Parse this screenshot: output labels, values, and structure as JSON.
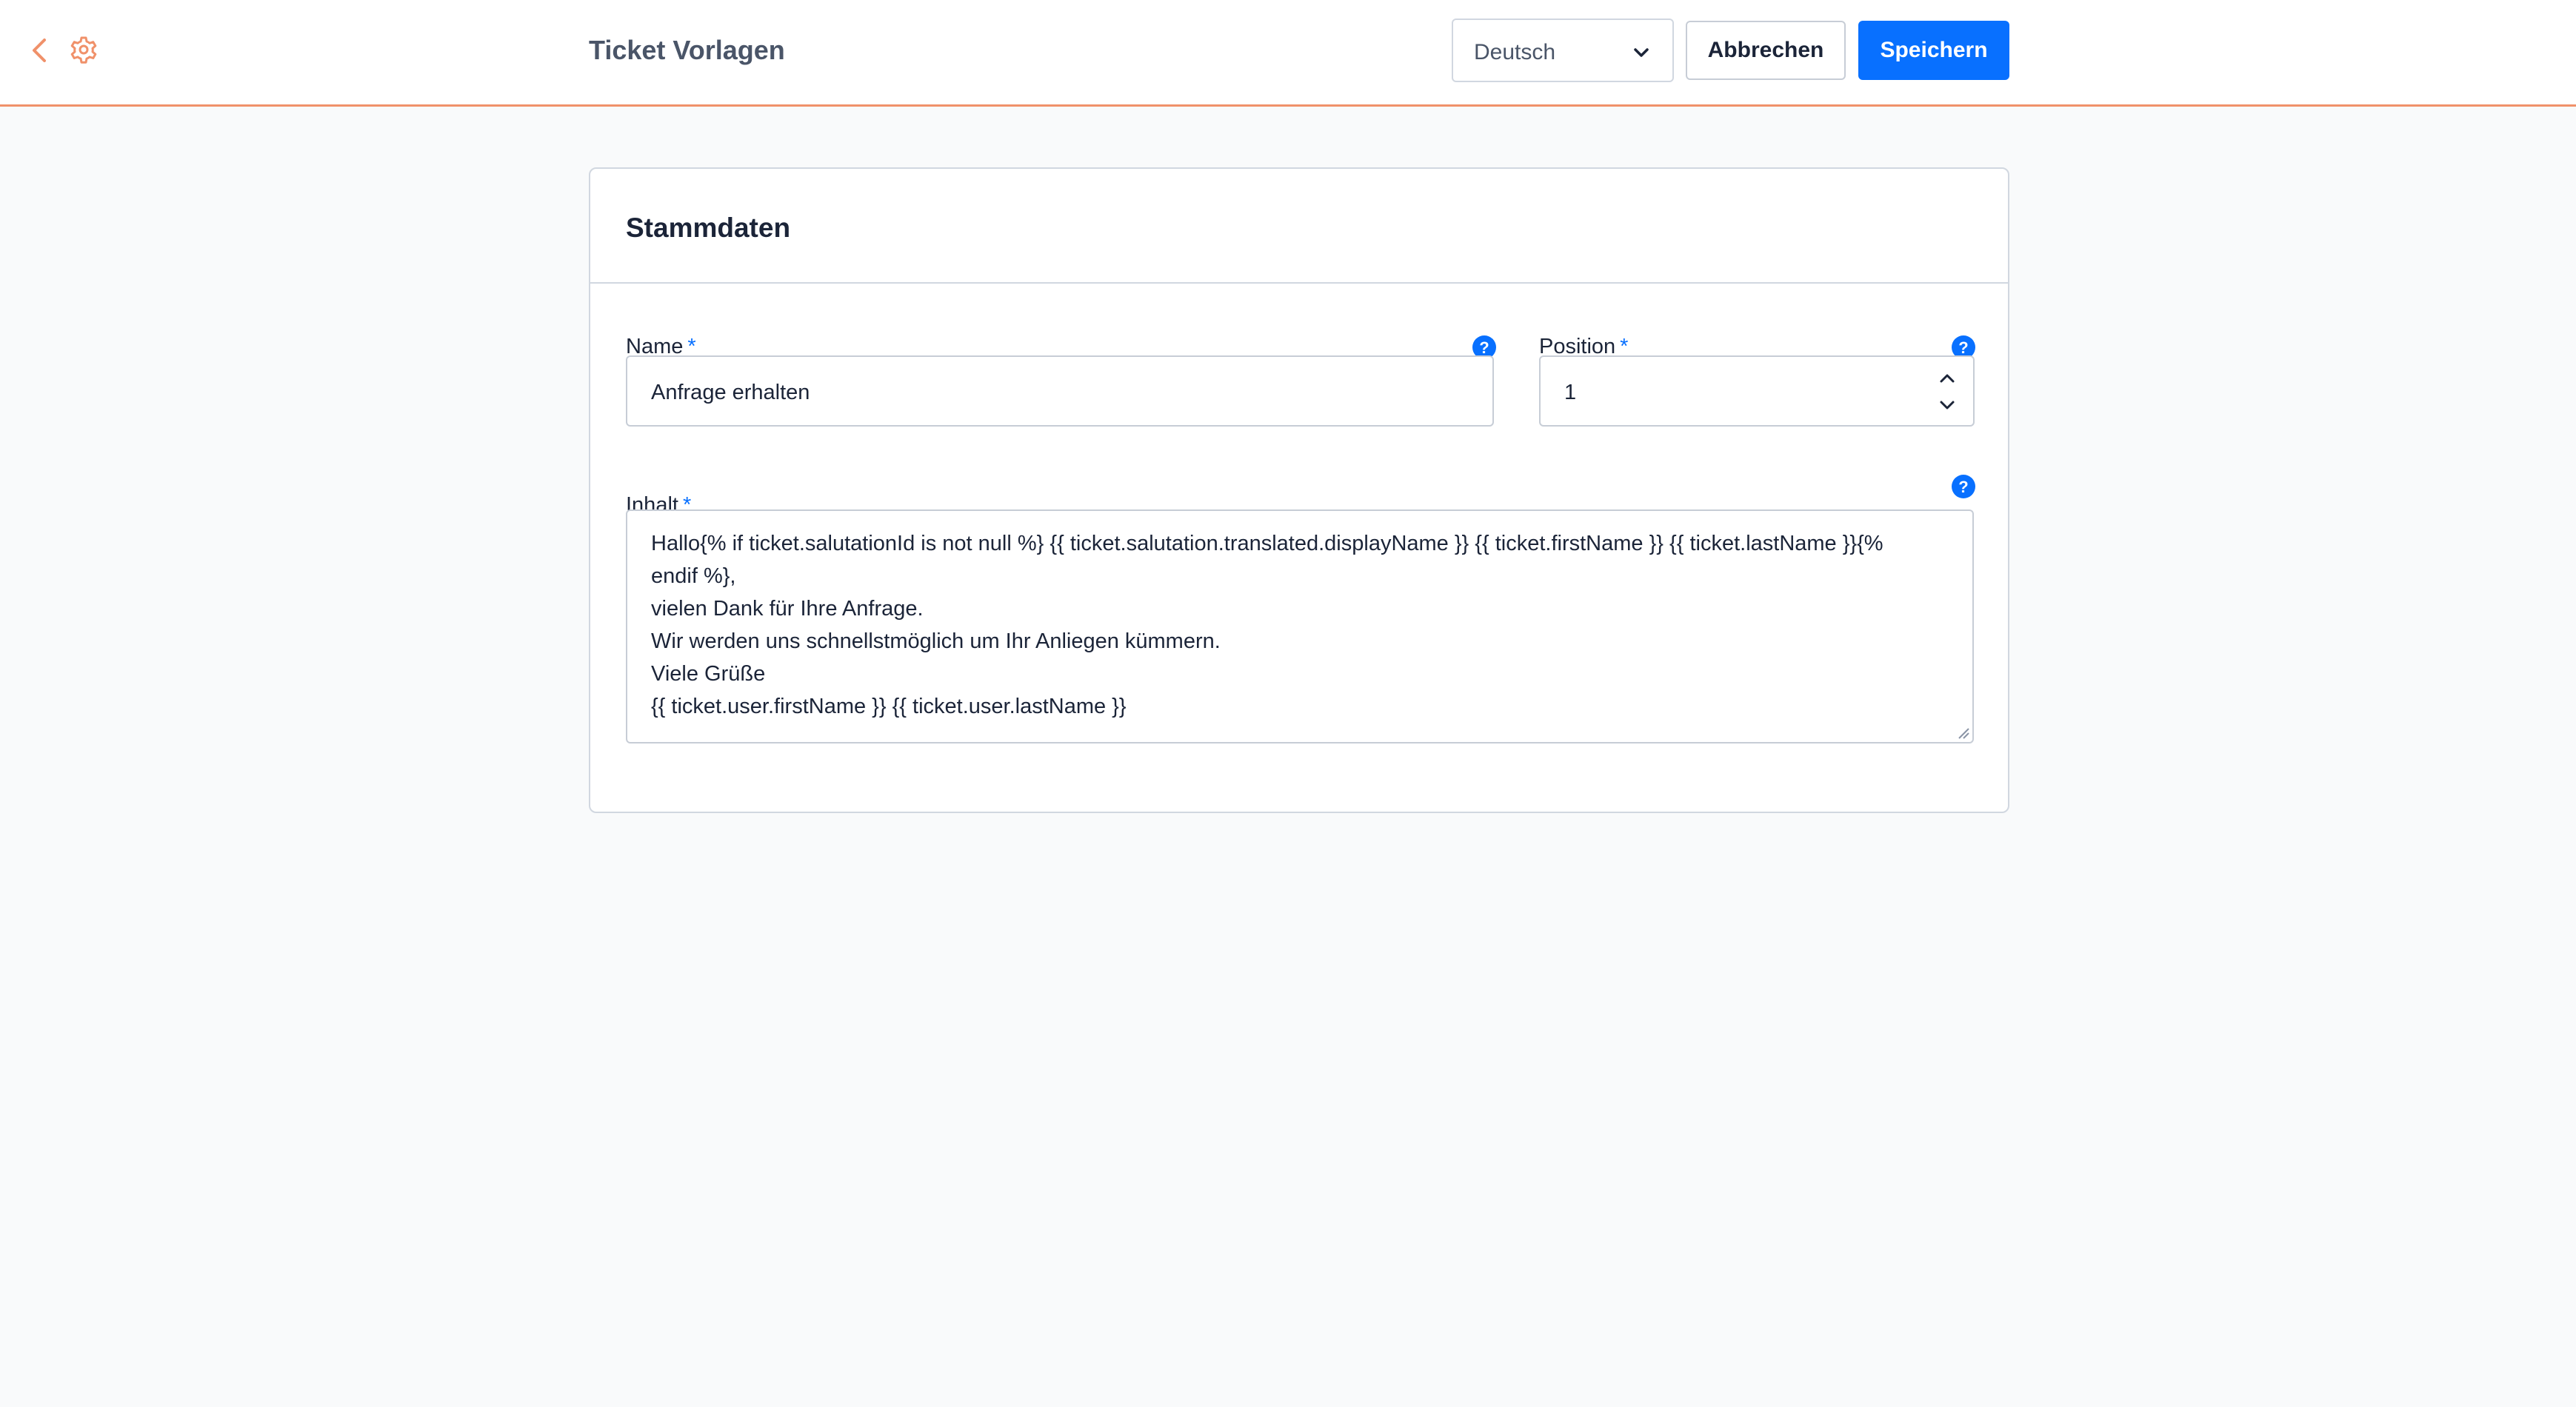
{
  "header": {
    "title": "Ticket Vorlagen",
    "language": {
      "selected": "Deutsch"
    },
    "cancel_label": "Abbrechen",
    "save_label": "Speichern"
  },
  "card": {
    "title": "Stammdaten",
    "fields": {
      "name": {
        "label": "Name",
        "required": "*",
        "value": "Anfrage erhalten"
      },
      "position": {
        "label": "Position",
        "required": "*",
        "value": "1"
      },
      "content": {
        "label": "Inhalt",
        "required": "*",
        "lines": [
          "Hallo{% if ticket.salutationId is not null %} {{ ticket.salutation.translated.displayName }} {{ ticket.firstName }} {{ ticket.lastName }}{%",
          "endif %},",
          "vielen Dank für Ihre Anfrage.",
          "Wir werden uns schnellstmöglich um Ihr Anliegen kümmern.",
          "Viele Grüße",
          "{{ ticket.user.firstName }} {{ ticket.user.lastName }}"
        ]
      }
    }
  },
  "colors": {
    "accent": "#f0916a",
    "primary": "#0870ff",
    "background": "#f9fafb"
  },
  "icons": [
    "chevron-left-icon",
    "gear-icon",
    "chevron-down-icon",
    "help-icon",
    "chevron-up-icon"
  ]
}
